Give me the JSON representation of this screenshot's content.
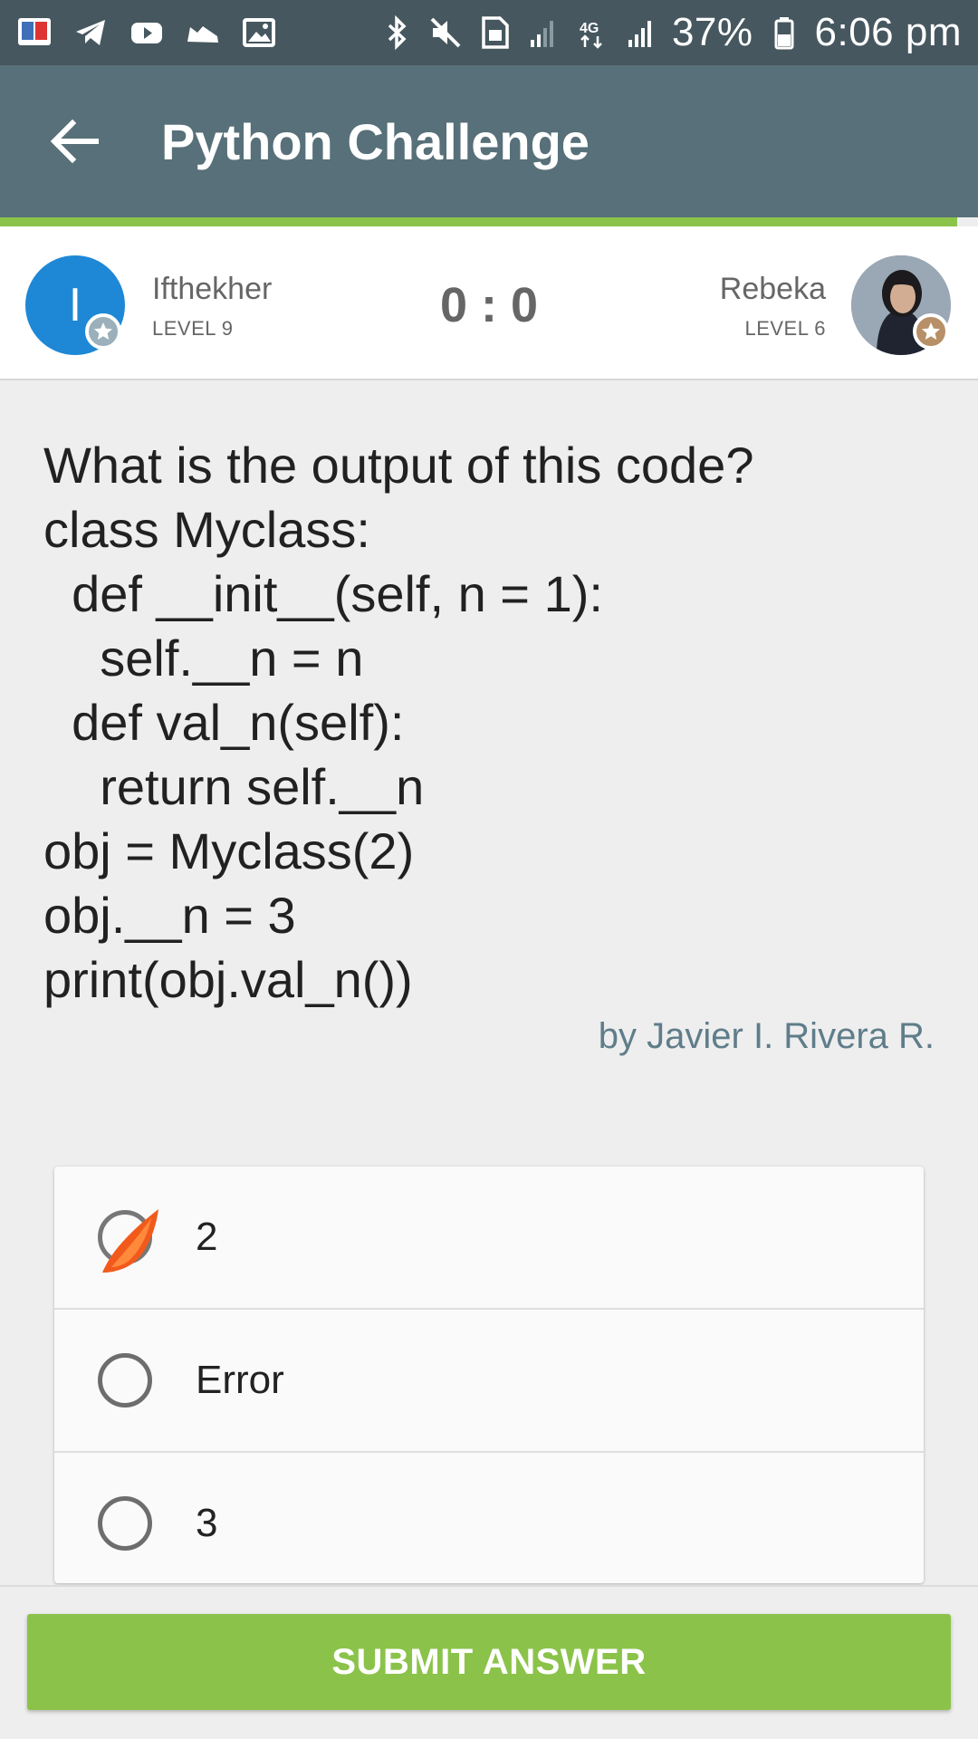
{
  "status_bar": {
    "icons_left": [
      "dictionary-app-icon",
      "telegram-icon",
      "youtube-icon",
      "shoe-icon",
      "gallery-icon"
    ],
    "icons_right": [
      "bluetooth-icon",
      "mute-icon",
      "hd-icon",
      "signal-icon",
      "4g-icon",
      "signal-icon-2",
      "battery-icon"
    ],
    "battery": "37%",
    "time": "6:06 pm"
  },
  "app_bar": {
    "title": "Python Challenge",
    "color": "#577079",
    "accent": "#8bc34a"
  },
  "players": {
    "left": {
      "initial": "I",
      "name": "Ifthekher",
      "level": "LEVEL 9",
      "avatar_color": "#1e88d6"
    },
    "right": {
      "name": "Rebeka",
      "level": "LEVEL 6"
    },
    "score": "0 : 0"
  },
  "question": {
    "text": "What is the output of this code?\nclass Myclass:\n  def __init__(self, n = 1):\n    self.__n = n\n  def val_n(self):\n    return self.__n\nobj = Myclass(2)\nobj.__n = 3\nprint(obj.val_n())",
    "author": "by Javier I. Rivera R."
  },
  "answers": [
    {
      "label": "2",
      "selected": true
    },
    {
      "label": "Error",
      "selected": false
    },
    {
      "label": "3",
      "selected": false
    }
  ],
  "submit": {
    "label": "SUBMIT ANSWER",
    "color": "#8bc34a"
  }
}
